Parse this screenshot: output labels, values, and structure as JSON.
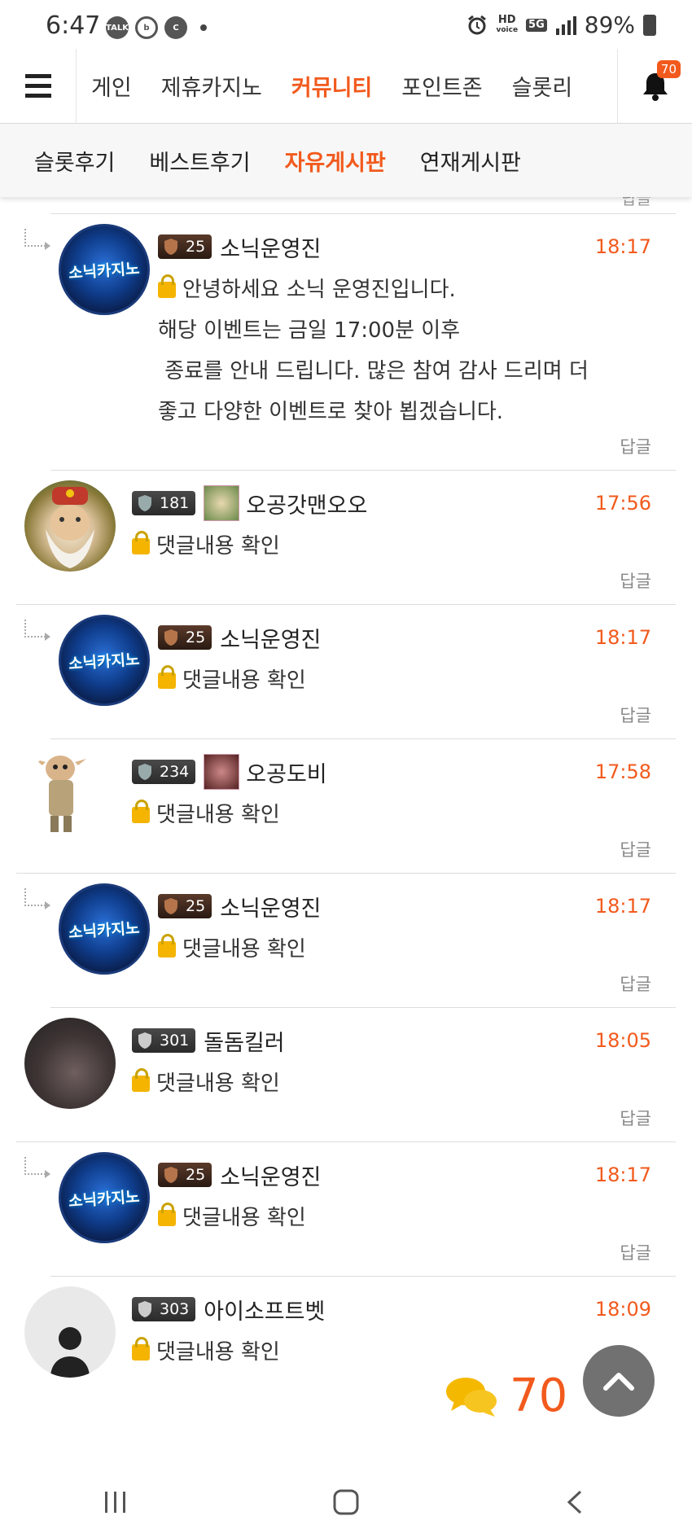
{
  "status_bar": {
    "time": "6:47",
    "icons": [
      "kakaotalk-icon",
      "band-icon",
      "c-app-icon",
      "dot-icon"
    ],
    "right_icons": [
      "alarm-icon",
      "hd-voice-icon",
      "5g-icon",
      "signal-icon"
    ],
    "hd_label": "HD",
    "voice_label": "voice",
    "net_label": "5G",
    "battery": "89%"
  },
  "top_nav": {
    "items": [
      {
        "label": "게인",
        "active": false
      },
      {
        "label": "제휴카지노",
        "active": false
      },
      {
        "label": "커뮤니티",
        "active": true
      },
      {
        "label": "포인트존",
        "active": false
      },
      {
        "label": "슬롯리",
        "active": false
      }
    ],
    "notification_count": "70"
  },
  "sub_nav": {
    "items": [
      {
        "label": "슬롯후기",
        "active": false
      },
      {
        "label": "베스트후기",
        "active": false
      },
      {
        "label": "자유게시판",
        "active": true
      },
      {
        "label": "연재게시판",
        "active": false
      }
    ]
  },
  "partial_reply": "답글",
  "comments": [
    {
      "nested": true,
      "avatar": "sonic-casino-avatar",
      "avatar_text": "소닉카지노",
      "level": "25",
      "level_style": "bronze",
      "name": "소닉운영진",
      "time": "18:17",
      "locked": true,
      "body_lines": [
        "안녕하세요 소닉 운영진입니다.",
        "해당 이벤트는 금일 17:00분 이후",
        " 종료를 안내 드립니다. 많은 참여 감사 드리며 더",
        "좋고 다양한 이벤트로 찾아 뵙겠습니다."
      ],
      "reply": "답글"
    },
    {
      "nested": false,
      "avatar": "wizard-avatar",
      "level": "181",
      "level_style": "dark",
      "has_userimg": true,
      "name": "오공갓맨오오",
      "time": "17:56",
      "locked": true,
      "body_lines": [
        "댓글내용 확인"
      ],
      "reply": "답글"
    },
    {
      "nested": true,
      "avatar": "sonic-casino-avatar",
      "avatar_text": "소닉카지노",
      "level": "25",
      "level_style": "bronze",
      "name": "소닉운영진",
      "time": "18:17",
      "locked": true,
      "body_lines": [
        "댓글내용 확인"
      ],
      "reply": "답글"
    },
    {
      "nested": false,
      "avatar": "goblin-avatar",
      "level": "234",
      "level_style": "dark",
      "has_userimg": true,
      "name": "오공도비",
      "time": "17:58",
      "locked": true,
      "body_lines": [
        "댓글내용 확인"
      ],
      "reply": "답글"
    },
    {
      "nested": true,
      "avatar": "sonic-casino-avatar",
      "avatar_text": "소닉카지노",
      "level": "25",
      "level_style": "bronze",
      "name": "소닉운영진",
      "time": "18:17",
      "locked": true,
      "body_lines": [
        "댓글내용 확인"
      ],
      "reply": "답글"
    },
    {
      "nested": false,
      "avatar": "rat-avatar",
      "level": "301",
      "level_style": "dark",
      "name": "돌돔킬러",
      "time": "18:05",
      "locked": true,
      "body_lines": [
        "댓글내용 확인"
      ],
      "reply": "답글"
    },
    {
      "nested": true,
      "avatar": "sonic-casino-avatar",
      "avatar_text": "소닉카지노",
      "level": "25",
      "level_style": "bronze",
      "name": "소닉운영진",
      "time": "18:17",
      "locked": true,
      "body_lines": [
        "댓글내용 확인"
      ],
      "reply": "답글"
    },
    {
      "nested": false,
      "avatar": "default-user-avatar",
      "level": "303",
      "level_style": "dark",
      "name": "아이소프트벳",
      "time": "18:09",
      "locked": true,
      "body_lines": [
        "댓글내용 확인"
      ],
      "reply": ""
    }
  ],
  "floating": {
    "comment_count": "70",
    "comment_icon": "speech-bubbles-icon",
    "scroll_top_icon": "chevron-up-icon"
  },
  "system_nav": [
    "recent-apps-icon",
    "home-icon",
    "back-icon"
  ],
  "colors": {
    "accent": "#f25a1d",
    "divider": "#dddddd",
    "sub_nav_bg": "#f7f7f7"
  }
}
